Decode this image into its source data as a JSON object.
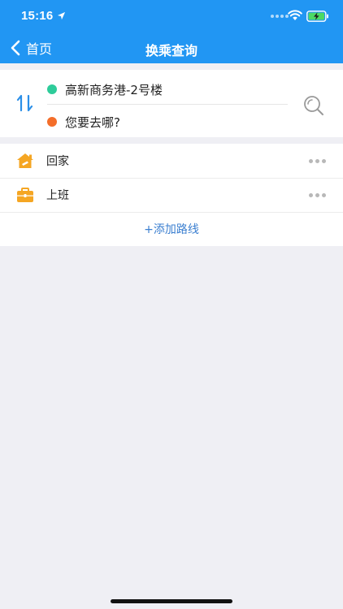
{
  "status_bar": {
    "time": "15:16"
  },
  "nav": {
    "back_label": "首页",
    "title": "换乘查询"
  },
  "route": {
    "from": "高新商务港-2号楼",
    "to": "您要去哪?",
    "from_color": "#2ecc9a",
    "to_color": "#f46e2a"
  },
  "saved": {
    "items": [
      {
        "label": "回家",
        "icon": "home-icon"
      },
      {
        "label": "上班",
        "icon": "briefcase-icon"
      }
    ],
    "add_label": "+添加路线"
  },
  "colors": {
    "header": "#2196f3",
    "accent": "#3b7fd0",
    "icon": "#f5a623"
  }
}
